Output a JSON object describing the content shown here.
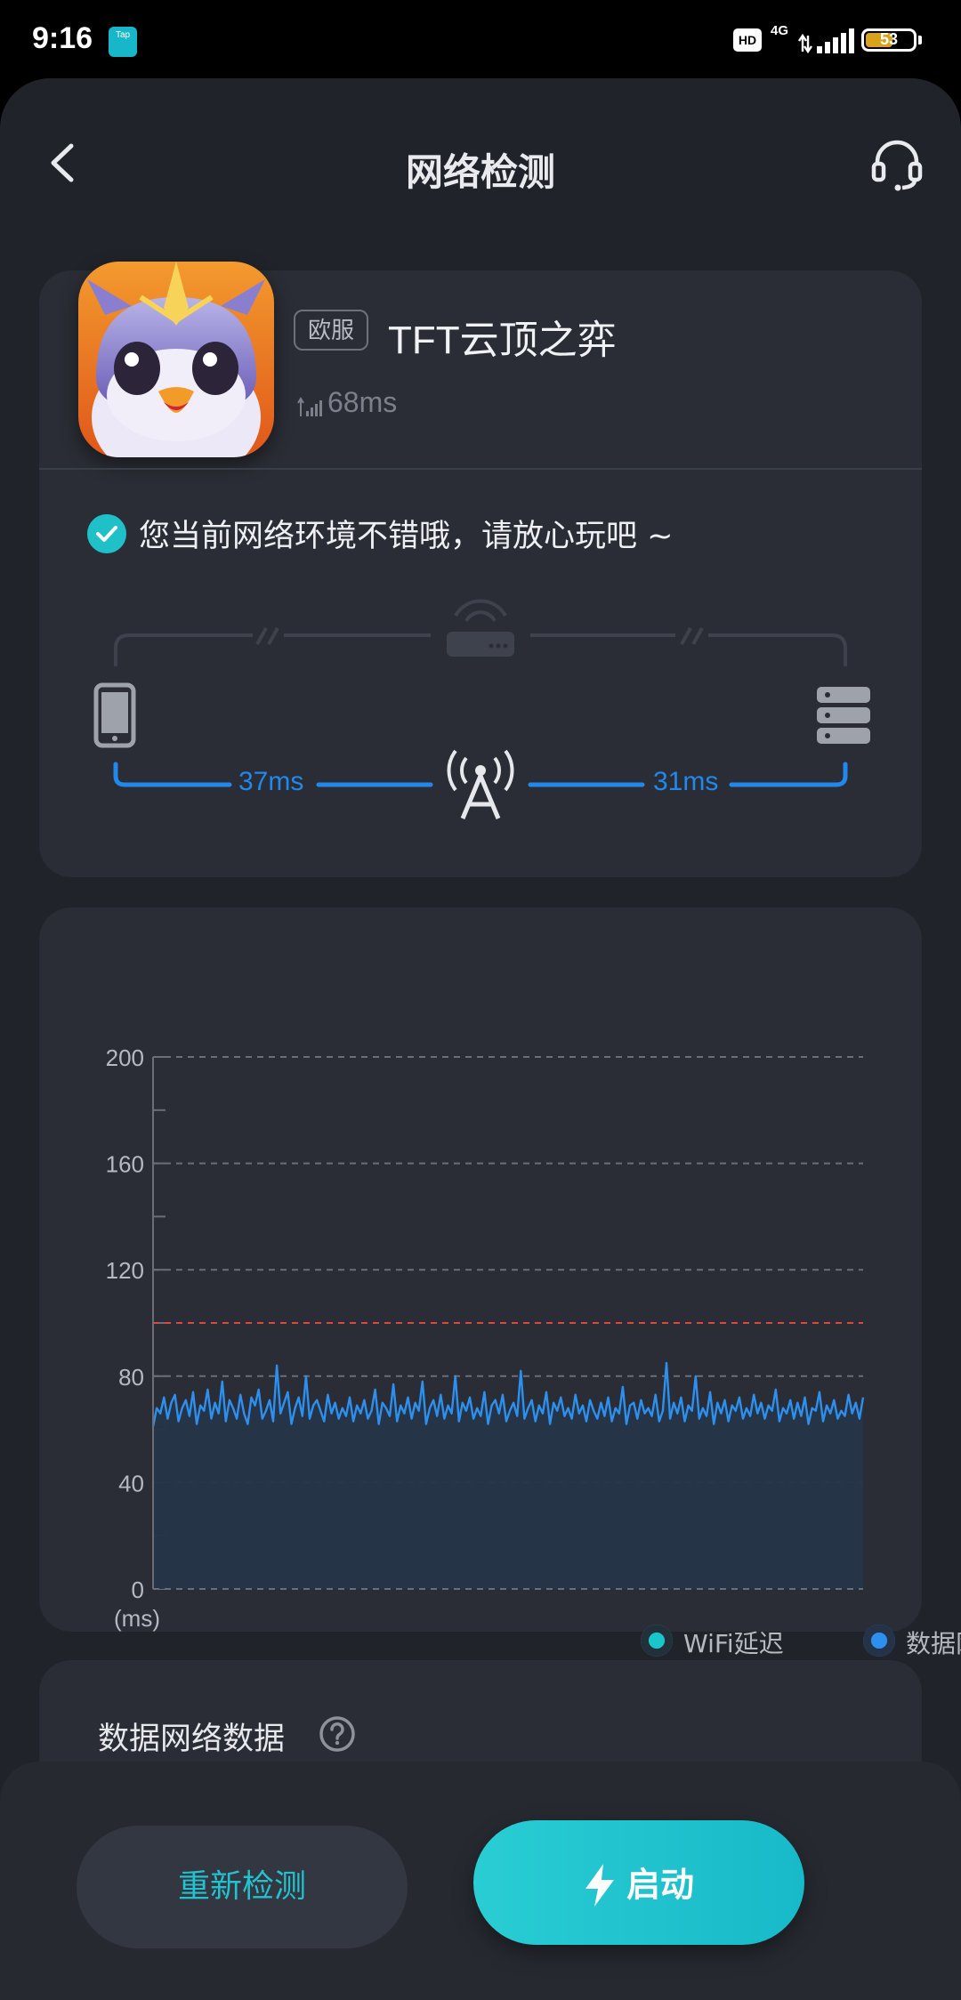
{
  "status_bar": {
    "time": "9:16",
    "tap_badge": "Tap",
    "hd": "HD",
    "network": "4G",
    "battery": "53"
  },
  "header": {
    "title": "网络检测"
  },
  "game": {
    "region": "欧服",
    "name": "TFT云顶之弈",
    "ping": "68ms"
  },
  "network_status": {
    "message": "您当前网络环境不错哦，请放心玩吧 ~",
    "left_latency": "37ms",
    "right_latency": "31ms"
  },
  "chart_data": {
    "type": "area",
    "title": "",
    "xlabel": "",
    "ylabel": "(ms)",
    "ylim": [
      0,
      200
    ],
    "y_ticks": [
      "0",
      "40",
      "80",
      "120",
      "160",
      "200"
    ],
    "threshold": 100,
    "grid": true,
    "legend_position": "bottom-right",
    "series": [
      {
        "name": "WiFi延迟",
        "color": "#18c6cc",
        "values": []
      },
      {
        "name": "数据网络延迟",
        "color": "#2d8fee",
        "values": [
          61,
          68,
          66,
          72,
          64,
          70,
          73,
          63,
          68,
          71,
          65,
          74,
          62,
          69,
          67,
          75,
          64,
          70,
          66,
          78,
          63,
          71,
          68,
          64,
          73,
          66,
          62,
          72,
          69,
          75,
          64,
          67,
          71,
          63,
          84,
          66,
          70,
          74,
          62,
          68,
          72,
          65,
          80,
          64,
          69,
          71,
          67,
          63,
          73,
          66,
          70,
          64,
          68,
          65,
          72,
          63,
          69,
          66,
          71,
          64,
          67,
          75,
          62,
          70,
          68,
          65,
          77,
          63,
          69,
          66,
          72,
          64,
          70,
          67,
          78,
          62,
          68,
          71,
          65,
          73,
          64,
          69,
          66,
          80,
          63,
          70,
          67,
          72,
          64,
          68,
          65,
          74,
          62,
          69,
          71,
          66,
          73,
          63,
          67,
          70,
          65,
          82,
          64,
          68,
          71,
          63,
          69,
          66,
          74,
          62,
          70,
          67,
          72,
          65,
          68,
          64,
          73,
          66,
          69,
          63,
          71,
          67,
          64,
          70,
          65,
          72,
          63,
          68,
          66,
          76,
          62,
          69,
          70,
          64,
          71,
          66,
          68,
          65,
          73,
          63,
          67,
          85,
          64,
          70,
          66,
          72,
          63,
          69,
          67,
          80,
          64,
          68,
          65,
          74,
          62,
          70,
          66,
          71,
          63,
          69,
          67,
          72,
          64,
          68,
          65,
          73,
          66,
          70,
          64,
          69,
          67,
          75,
          63,
          68,
          66,
          71,
          64,
          70,
          65,
          72,
          62,
          68,
          67,
          74,
          63,
          69,
          66,
          71,
          64,
          67,
          65,
          73,
          66,
          70,
          64,
          72
        ]
      }
    ]
  },
  "section": {
    "title": "数据网络数据"
  },
  "buttons": {
    "retest": "重新检测",
    "start": "启动"
  }
}
